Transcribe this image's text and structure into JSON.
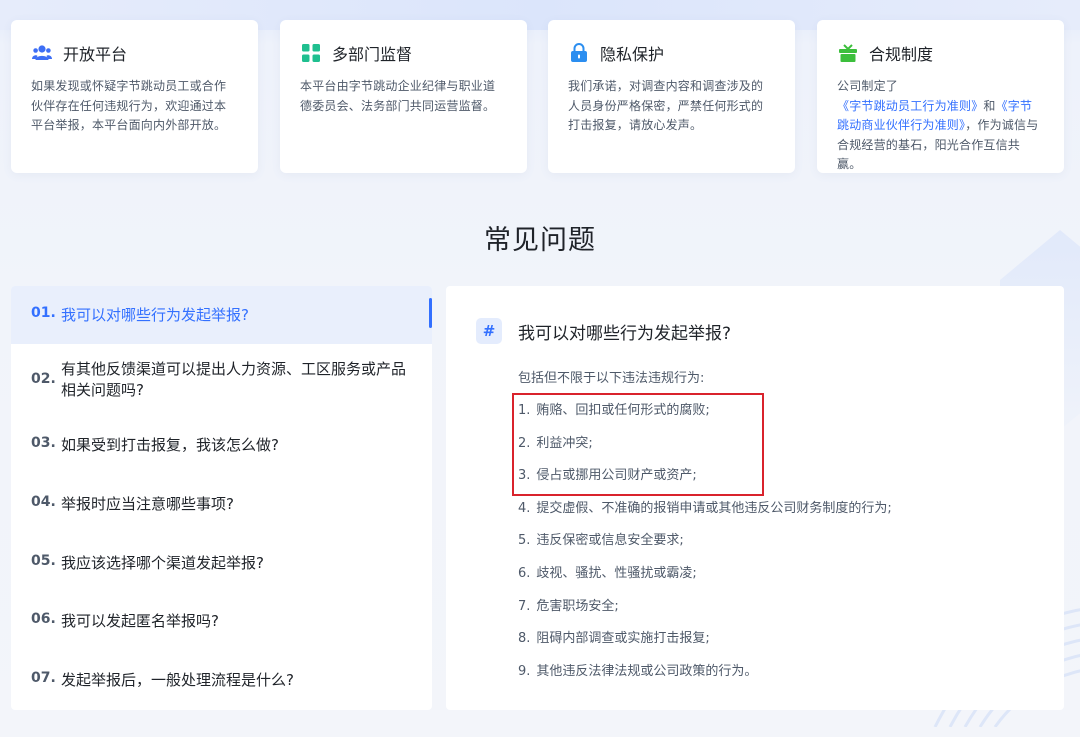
{
  "cards": [
    {
      "icon": "people-icon",
      "title": "开放平台",
      "desc_parts": [
        {
          "text": "如果发现或怀疑字节跳动员工或合作伙伴存在任何违规行为，欢迎通过本平台举报，本平台面向内外部开放。",
          "link": false
        }
      ]
    },
    {
      "icon": "grid-icon",
      "title": "多部门监督",
      "desc_parts": [
        {
          "text": "本平台由字节跳动企业纪律与职业道德委员会、法务部门共同运营监督。",
          "link": false
        }
      ]
    },
    {
      "icon": "lock-icon",
      "title": "隐私保护",
      "desc_parts": [
        {
          "text": "我们承诺，对调查内容和调查涉及的人员身份严格保密，严禁任何形式的打击报复，请放心发声。",
          "link": false
        }
      ]
    },
    {
      "icon": "gift-icon",
      "title": "合规制度",
      "desc_parts": [
        {
          "text": "公司制定了",
          "link": false
        },
        {
          "text": "《字节跳动员工行为准则》",
          "link": true
        },
        {
          "text": "和",
          "link": false
        },
        {
          "text": "《字节跳动商业伙伴行为准则》",
          "link": true
        },
        {
          "text": "，作为诚信与合规经营的基石，阳光合作互信共赢。",
          "link": false
        }
      ]
    }
  ],
  "faq_title": "常见问题",
  "faq": [
    {
      "num": "01.",
      "text": "我可以对哪些行为发起举报?"
    },
    {
      "num": "02.",
      "text": "有其他反馈渠道可以提出人力资源、工区服务或产品相关问题吗?"
    },
    {
      "num": "03.",
      "text": "如果受到打击报复，我该怎么做?"
    },
    {
      "num": "04.",
      "text": "举报时应当注意哪些事项?"
    },
    {
      "num": "05.",
      "text": "我应该选择哪个渠道发起举报?"
    },
    {
      "num": "06.",
      "text": "我可以发起匿名举报吗?"
    },
    {
      "num": "07.",
      "text": "发起举报后，一般处理流程是什么?"
    }
  ],
  "active_faq": 0,
  "answer": {
    "hash": "#",
    "title": "我可以对哪些行为发起举报?",
    "intro": "包括但不限于以下违法违规行为:",
    "items": [
      {
        "n": "1.",
        "text": "贿赂、回扣或任何形式的腐败;"
      },
      {
        "n": "2.",
        "text": "利益冲突;"
      },
      {
        "n": "3.",
        "text": "侵占或挪用公司财产或资产;"
      },
      {
        "n": "4.",
        "text": "提交虚假、不准确的报销申请或其他违反公司财务制度的行为;"
      },
      {
        "n": "5.",
        "text": "违反保密或信息安全要求;"
      },
      {
        "n": "6.",
        "text": "歧视、骚扰、性骚扰或霸凌;"
      },
      {
        "n": "7.",
        "text": "危害职场安全;"
      },
      {
        "n": "8.",
        "text": "阻碍内部调查或实施打击报复;"
      },
      {
        "n": "9.",
        "text": "其他违反法律法规或公司政策的行为。"
      }
    ]
  },
  "colors": {
    "accent": "#3370ff",
    "highlight_box": "#d9232c",
    "people_icon": "#3d6ef5",
    "grid_icon": "#1fbf8f",
    "lock_icon": "#2b8ef0",
    "gift_icon": "#3cbf3c"
  }
}
